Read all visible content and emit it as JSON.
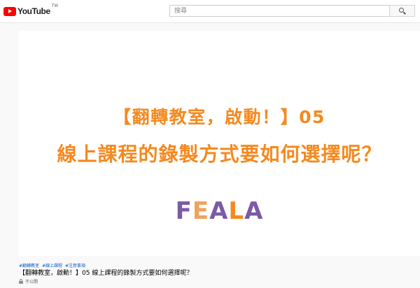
{
  "header": {
    "logo_text": "YouTube",
    "logo_region": "TW",
    "search_placeholder": "搜尋"
  },
  "player": {
    "title_line1": "【翻轉教室，啟動！】05",
    "title_line2": "線上課程的錄製方式要如何選擇呢？",
    "brand": [
      "F",
      "E",
      "A",
      "L",
      "A"
    ],
    "colors": {
      "orange": "#f5891f",
      "purple": "#7b5aa6"
    }
  },
  "video": {
    "hashtags": [
      "#翻轉教室",
      "#線上課程",
      "#注意事項"
    ],
    "title": "【翻轉教室，啟動！】05 線上課程的錄製方式要如何選擇呢？",
    "privacy": "不公開"
  }
}
